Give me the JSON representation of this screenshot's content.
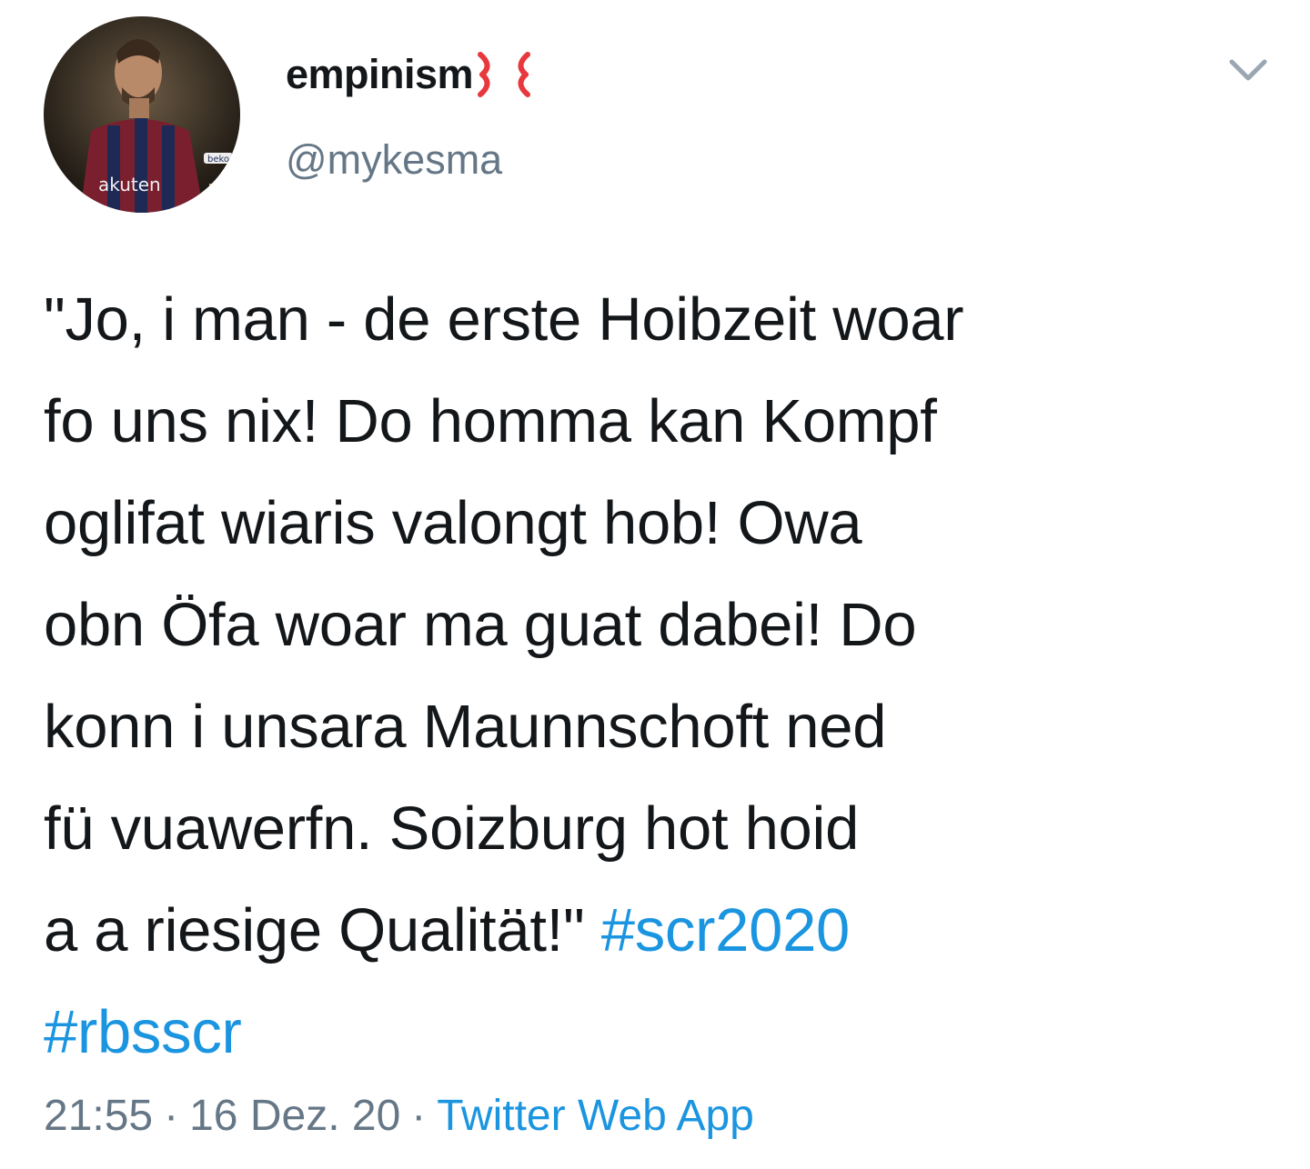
{
  "author": {
    "display_name": "empinism",
    "handle": "@mykesma",
    "avatar_icon": "profile-photo"
  },
  "tweet": {
    "lines": [
      "\"Jo, i man - de erste Hoibzeit woar",
      "fo uns nix! Do homma kan Kompf",
      "oglifat wiaris valongt hob! Owa",
      "obn Öfa woar ma guat dabei! Do",
      "konn i unsara Maunnschoft ned",
      "fü vuawerfn. Soizburg hot hoid",
      "a a riesige Qualität!\""
    ],
    "hashtags": [
      "#scr2020",
      "#rbsscr"
    ]
  },
  "meta": {
    "time": "21:55",
    "separator": "·",
    "date": "16 Dez. 20",
    "source": "Twitter Web App"
  },
  "colors": {
    "text": "#14171a",
    "secondary": "#657786",
    "link": "#1b95e0",
    "anger": "#e8383d"
  }
}
